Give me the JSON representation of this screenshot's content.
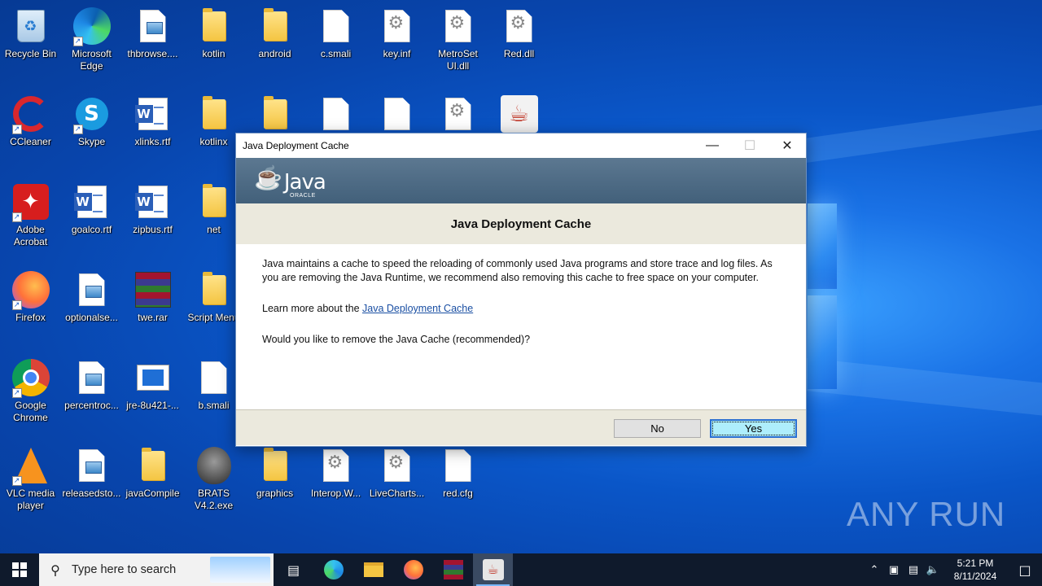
{
  "desktop": {
    "icons": [
      {
        "label": "Recycle Bin",
        "icon": "recycle-bin-icon"
      },
      {
        "label": "Microsoft Edge",
        "icon": "edge-icon"
      },
      {
        "label": "thbrowse....",
        "icon": "image-file-icon"
      },
      {
        "label": "kotlin",
        "icon": "folder-icon"
      },
      {
        "label": "android",
        "icon": "folder-icon"
      },
      {
        "label": "c.smali",
        "icon": "file-icon"
      },
      {
        "label": "key.inf",
        "icon": "gear-file-icon"
      },
      {
        "label": "MetroSet UI.dll",
        "icon": "gear-file-icon"
      },
      {
        "label": "Red.dll",
        "icon": "gear-file-icon"
      },
      {
        "label": "CCleaner",
        "icon": "ccleaner-icon"
      },
      {
        "label": "Skype",
        "icon": "skype-icon"
      },
      {
        "label": "xlinks.rtf",
        "icon": "word-doc-icon"
      },
      {
        "label": "kotlinx",
        "icon": "folder-icon"
      },
      {
        "label": "",
        "icon": "folder-icon"
      },
      {
        "label": "",
        "icon": "file-icon"
      },
      {
        "label": "",
        "icon": "file-icon"
      },
      {
        "label": "",
        "icon": "gear-file-icon"
      },
      {
        "label": "",
        "icon": "java-icon"
      },
      {
        "label": "Adobe Acrobat",
        "icon": "acrobat-icon"
      },
      {
        "label": "goalco.rtf",
        "icon": "word-doc-icon"
      },
      {
        "label": "zipbus.rtf",
        "icon": "word-doc-icon"
      },
      {
        "label": "net",
        "icon": "folder-icon"
      },
      {
        "label": "Firefox",
        "icon": "firefox-icon"
      },
      {
        "label": "optionalse...",
        "icon": "image-file-icon"
      },
      {
        "label": "twe.rar",
        "icon": "winrar-icon"
      },
      {
        "label": "Script Menu",
        "icon": "folder-icon"
      },
      {
        "label": "Google Chrome",
        "icon": "chrome-icon"
      },
      {
        "label": "percentroc...",
        "icon": "image-file-icon"
      },
      {
        "label": "jre-8u421-...",
        "icon": "installer-icon"
      },
      {
        "label": "b.smali",
        "icon": "file-icon"
      },
      {
        "label": "VLC media player",
        "icon": "vlc-icon"
      },
      {
        "label": "releasedsto...",
        "icon": "image-file-icon"
      },
      {
        "label": "javaCompile",
        "icon": "folder-icon"
      },
      {
        "label": "BRATS V4.2.exe",
        "icon": "alien-exe-icon"
      },
      {
        "label": "graphics",
        "icon": "folder-icon"
      },
      {
        "label": "Interop.W...",
        "icon": "gear-file-icon"
      },
      {
        "label": "LiveCharts...",
        "icon": "gear-file-icon"
      },
      {
        "label": "red.cfg",
        "icon": "file-icon"
      }
    ]
  },
  "dialog": {
    "title": "Java Deployment Cache",
    "logo_text": "Java",
    "logo_sub": "ORACLE",
    "heading": "Java Deployment Cache",
    "paragraph1": "Java maintains a cache to speed the reloading of commonly used Java programs and store trace and log files. As you are removing the Java Runtime, we recommend also removing this cache to free space on your computer.",
    "learn_prefix": "Learn more about the ",
    "learn_link": "Java Deployment Cache",
    "question": "Would you like to remove the Java Cache (recommended)?",
    "no_label": "No",
    "yes_label": "Yes"
  },
  "taskbar": {
    "search_placeholder": "Type here to search",
    "time": "5:21 PM",
    "date": "8/11/2024"
  },
  "watermark": "ANY RUN"
}
